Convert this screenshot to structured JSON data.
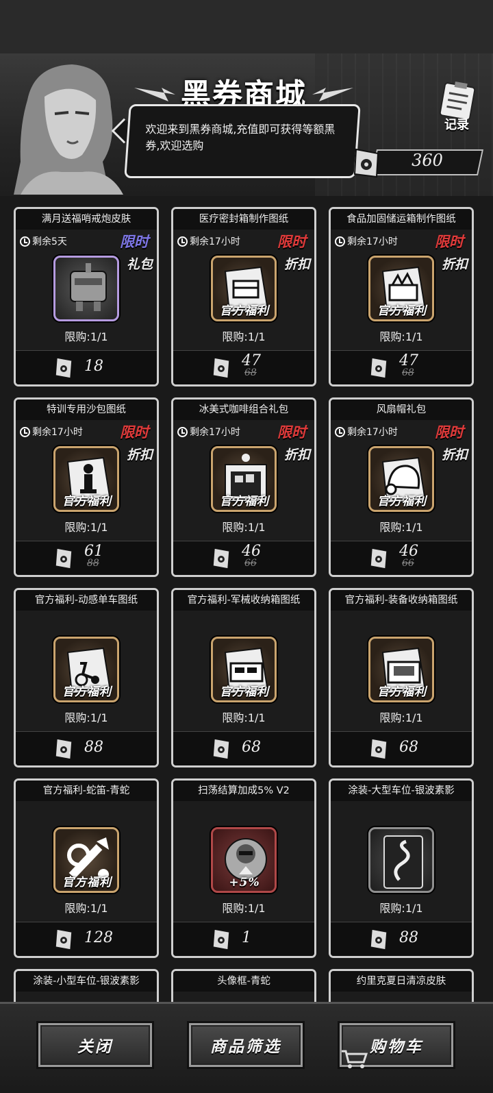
{
  "header": {
    "title": "黑券商城",
    "welcome": "欢迎来到黑券商城,充值即可获得等额黑券,欢迎选购",
    "record_label": "记录",
    "balance": "360"
  },
  "products": [
    {
      "name": "满月送福哨戒炮皮肤",
      "timer": "剩余5天",
      "tag": "限时",
      "tag_color": "#7d76e6",
      "side": "礼包",
      "frame": "purple",
      "icon": "turret",
      "fuli": "",
      "limit": "限购:1/1",
      "price": "18",
      "old": ""
    },
    {
      "name": "医疗密封箱制作图纸",
      "timer": "剩余17小时",
      "tag": "限时",
      "tag_color": "#e03a3a",
      "side": "折扣",
      "frame": "gold",
      "icon": "chest",
      "fuli": "官方福利",
      "limit": "限购:1/1",
      "price": "47",
      "old": "68"
    },
    {
      "name": "食品加固储运箱制作图纸",
      "timer": "剩余17小时",
      "tag": "限时",
      "tag_color": "#e03a3a",
      "side": "折扣",
      "frame": "gold",
      "icon": "crate",
      "fuli": "官方福利",
      "limit": "限购:1/1",
      "price": "47",
      "old": "68"
    },
    {
      "name": "特训专用沙包图纸",
      "timer": "剩余17小时",
      "tag": "限时",
      "tag_color": "#e03a3a",
      "side": "折扣",
      "frame": "gold",
      "icon": "sandbag",
      "fuli": "官方福利",
      "limit": "限购:1/1",
      "price": "61",
      "old": "88"
    },
    {
      "name": "冰美式咖啡组合礼包",
      "timer": "剩余17小时",
      "tag": "限时",
      "tag_color": "#e03a3a",
      "side": "折扣",
      "frame": "gold",
      "icon": "coffee",
      "fuli": "官方福利",
      "limit": "限购:1/1",
      "price": "46",
      "old": "66"
    },
    {
      "name": "风扇帽礼包",
      "timer": "剩余17小时",
      "tag": "限时",
      "tag_color": "#e03a3a",
      "side": "折扣",
      "frame": "gold",
      "icon": "hat",
      "fuli": "官方福利",
      "limit": "限购:1/1",
      "price": "46",
      "old": "66"
    },
    {
      "name": "官方福利-动感单车图纸",
      "timer": "",
      "tag": "",
      "tag_color": "",
      "side": "",
      "frame": "gold",
      "icon": "bike",
      "fuli": "官方福利",
      "limit": "限购:1/1",
      "price": "88",
      "old": ""
    },
    {
      "name": "官方福利-军械收纳箱图纸",
      "timer": "",
      "tag": "",
      "tag_color": "",
      "side": "",
      "frame": "gold",
      "icon": "armory",
      "fuli": "官方福利",
      "limit": "限购:1/1",
      "price": "68",
      "old": ""
    },
    {
      "name": "官方福利-装备收纳箱图纸",
      "timer": "",
      "tag": "",
      "tag_color": "",
      "side": "",
      "frame": "gold",
      "icon": "gear",
      "fuli": "官方福利",
      "limit": "限购:1/1",
      "price": "68",
      "old": ""
    },
    {
      "name": "官方福利-蛇笛-青蛇",
      "timer": "",
      "tag": "",
      "tag_color": "",
      "side": "",
      "frame": "gold",
      "icon": "flute",
      "fuli": "官方福利",
      "limit": "限购:1/1",
      "price": "128",
      "old": ""
    },
    {
      "name": "扫荡结算加成5% V2",
      "timer": "",
      "tag": "",
      "tag_color": "",
      "side": "",
      "frame": "red",
      "icon": "boost",
      "fuli": "+5%",
      "limit": "限购:1/1",
      "price": "1",
      "old": ""
    },
    {
      "name": "涂装-大型车位-银波素影",
      "timer": "",
      "tag": "",
      "tag_color": "",
      "side": "",
      "frame": "gray",
      "icon": "snake",
      "fuli": "",
      "limit": "限购:1/1",
      "price": "88",
      "old": ""
    }
  ],
  "partial_products": [
    "涂装-小型车位-银波素影",
    "头像框-青蛇",
    "约里克夏日清凉皮肤"
  ],
  "footer": {
    "close": "关闭",
    "filter": "商品筛选",
    "cart": "购物车"
  }
}
